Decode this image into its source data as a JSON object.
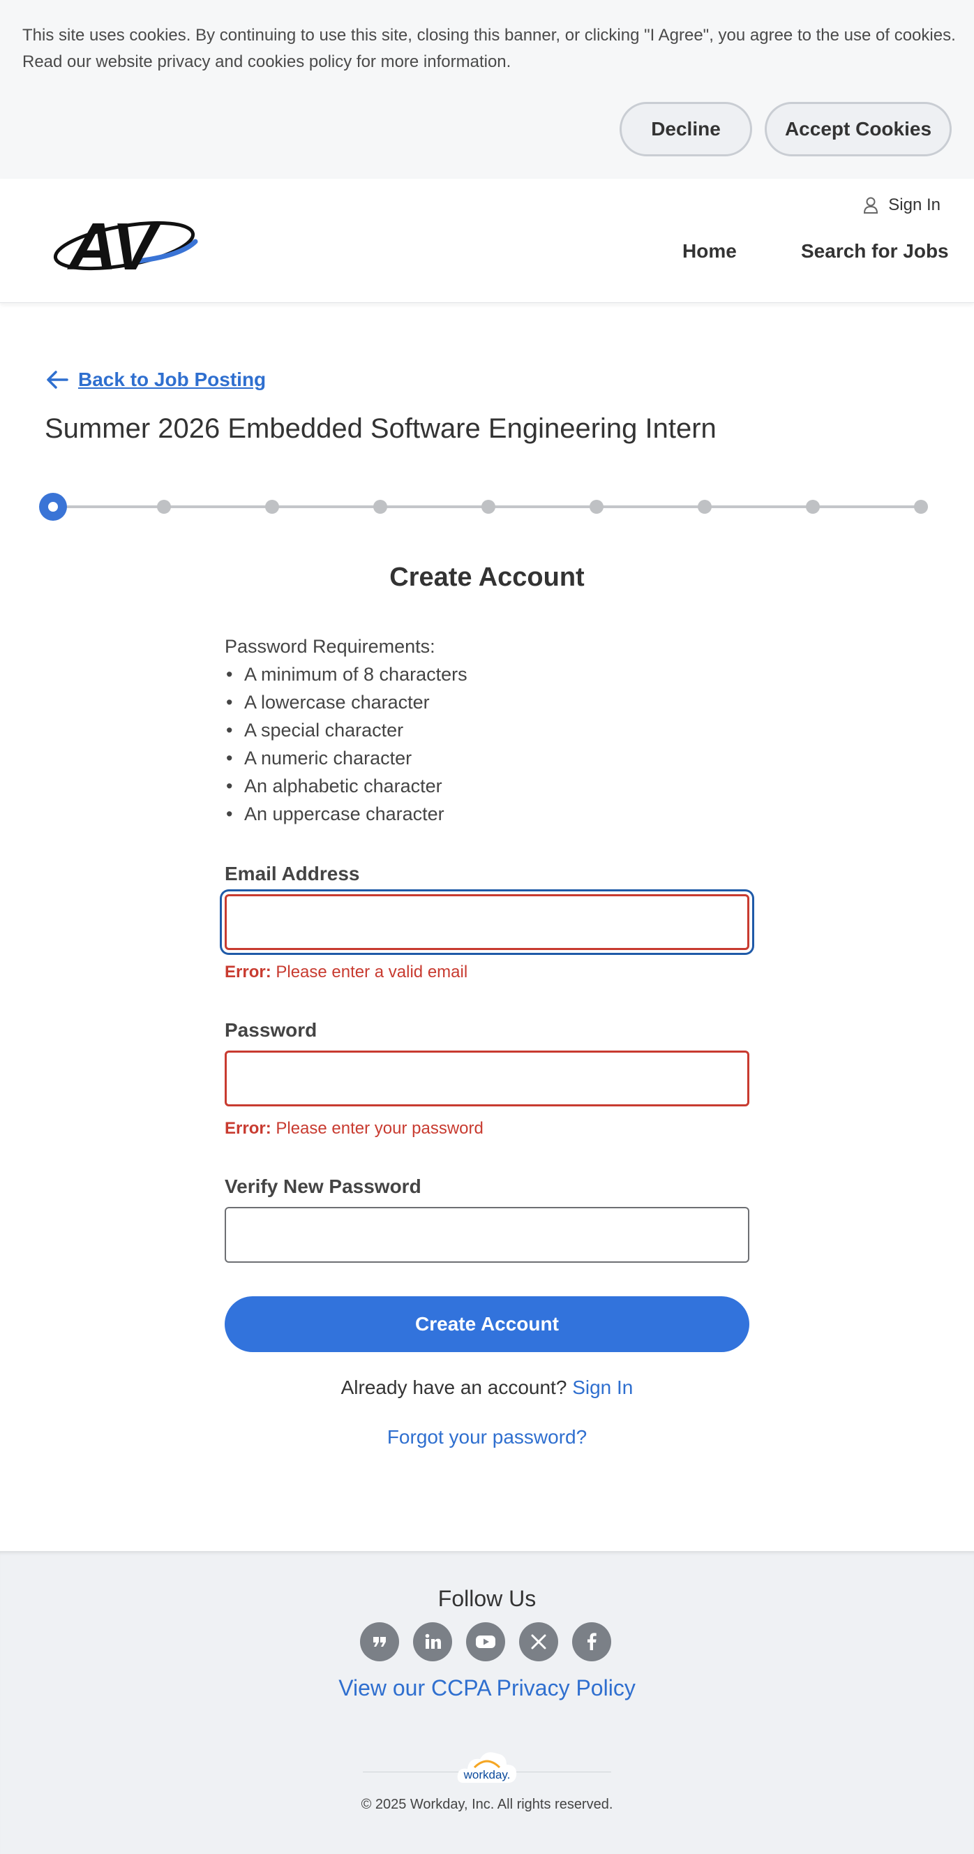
{
  "cookie_banner": {
    "text_line1": "This site uses cookies. By continuing to use this site, closing this banner, or clicking \"I Agree\", you agree to the use of cookies.",
    "text_line2": "Read our website privacy and cookies policy for more information.",
    "decline_label": "Decline",
    "accept_label": "Accept Cookies"
  },
  "header": {
    "logo_text": "AV",
    "sign_in_label": "Sign In",
    "nav": [
      "Home",
      "Search for Jobs"
    ]
  },
  "main": {
    "back_label": "Back to Job Posting",
    "job_title": "Summer 2026 Embedded Software Engineering Intern",
    "stepper": {
      "total_steps": 9,
      "current_step": 1
    },
    "form_title": "Create Account",
    "requirements_heading": "Password Requirements:",
    "requirements": [
      "A minimum of 8 characters",
      "A lowercase character",
      "A special character",
      "A numeric character",
      "An alphabetic character",
      "An uppercase character"
    ],
    "fields": {
      "email": {
        "label": "Email Address",
        "value": "",
        "error_prefix": "Error:",
        "error_text": "Please enter a valid email"
      },
      "password": {
        "label": "Password",
        "value": "",
        "error_prefix": "Error:",
        "error_text": "Please enter your password"
      },
      "verify": {
        "label": "Verify New Password",
        "value": ""
      }
    },
    "create_label": "Create Account",
    "already_text": "Already have an account?",
    "sign_in_link": "Sign In",
    "forgot_link": "Forgot your password?"
  },
  "footer": {
    "follow_label": "Follow Us",
    "socials": [
      "quote-icon",
      "linkedin-icon",
      "youtube-icon",
      "x-icon",
      "facebook-icon"
    ],
    "ccpa_link": "View our CCPA Privacy Policy",
    "workday_logo_text": "workday.",
    "copyright": "© 2025 Workday, Inc. All rights reserved."
  },
  "colors": {
    "accent": "#3273dc",
    "link": "#2f6fcf",
    "error": "#c83b30",
    "focus": "#1f5aa8",
    "footer_bg": "#eff1f4"
  }
}
